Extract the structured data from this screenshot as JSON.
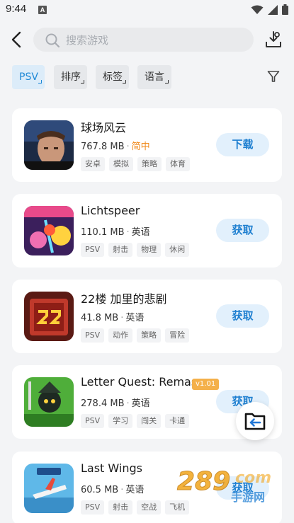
{
  "status_bar": {
    "time": "9:44",
    "notif_letter": "A"
  },
  "search": {
    "placeholder": "搜索游戏"
  },
  "filters": [
    {
      "label": "PSV",
      "active": true
    },
    {
      "label": "排序",
      "active": false
    },
    {
      "label": "标签",
      "active": false
    },
    {
      "label": "语言",
      "active": false
    }
  ],
  "games": [
    {
      "title": "球场风云",
      "size": "767.8 MB",
      "lang": "简中",
      "lang_highlight": true,
      "tags": [
        "安卓",
        "模拟",
        "策略",
        "体育"
      ],
      "action": "下载"
    },
    {
      "title": "Lichtspeer",
      "size": "110.1 MB",
      "lang": "英语",
      "tags": [
        "PSV",
        "射击",
        "物理",
        "休闲"
      ],
      "action": "获取"
    },
    {
      "title": "22楼 加里的悲剧",
      "size": "41.8 MB",
      "lang": "英语",
      "tags": [
        "PSV",
        "动作",
        "策略",
        "冒险"
      ],
      "action": "获取"
    },
    {
      "title": "Letter Quest: Remas",
      "badge": "v1.01",
      "size": "278.4 MB",
      "lang": "英语",
      "tags": [
        "PSV",
        "学习",
        "闯关",
        "卡通"
      ],
      "action": "获取"
    },
    {
      "title": "Last Wings",
      "size": "60.5 MB",
      "lang": "英语",
      "tags": [
        "PSV",
        "射击",
        "空战",
        "飞机"
      ],
      "action": "获取"
    }
  ],
  "watermark": {
    "number": "289",
    "domain": "com",
    "site": "手游网"
  },
  "colors": {
    "accent": "#1e88d6",
    "orange": "#f08a1c",
    "badge": "#f4b04a",
    "background": "#f3f4f6"
  }
}
